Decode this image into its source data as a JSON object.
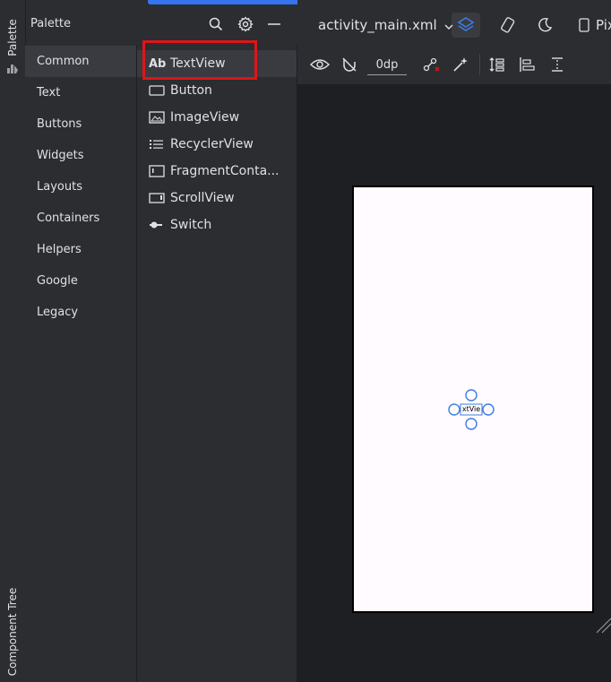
{
  "strip": {
    "palette": "Palette",
    "component_tree": "Component Tree"
  },
  "palette": {
    "title": "Palette",
    "categories": [
      "Common",
      "Text",
      "Buttons",
      "Widgets",
      "Layouts",
      "Containers",
      "Helpers",
      "Google",
      "Legacy"
    ],
    "selected_category": "Common",
    "widgets": [
      {
        "icon": "ab-text-icon",
        "label": "TextView"
      },
      {
        "icon": "button-icon",
        "label": "Button"
      },
      {
        "icon": "image-icon",
        "label": "ImageView"
      },
      {
        "icon": "list-icon",
        "label": "RecyclerView"
      },
      {
        "icon": "fragment-icon",
        "label": "FragmentConta..."
      },
      {
        "icon": "scroll-icon",
        "label": "ScrollView"
      },
      {
        "icon": "switch-icon",
        "label": "Switch"
      }
    ]
  },
  "editor": {
    "filename": "activity_main.xml",
    "device_label": "Pix",
    "margin_value": "0dp",
    "preview_text": "xtVie"
  },
  "colors": {
    "accent": "#3574f0",
    "highlight": "#e0141b",
    "selection": "#3d7be0"
  }
}
